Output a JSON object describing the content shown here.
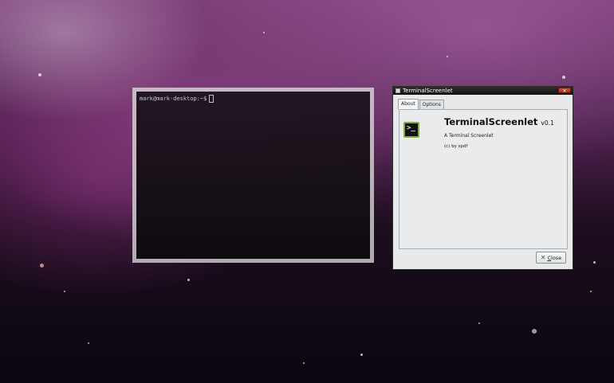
{
  "terminal": {
    "prompt": "mark@mark-desktop:~$"
  },
  "dialog": {
    "title": "TerminalScreenlet",
    "tabs": [
      {
        "label": "About",
        "active": true
      },
      {
        "label": "Options",
        "active": false
      }
    ],
    "about": {
      "app_icon": "terminal-icon",
      "name": "TerminalScreenlet",
      "version": "v0.1",
      "description": "A Terminal Screenlet",
      "copyright": "(c) by spdf"
    },
    "close_button": {
      "icon": "close-icon",
      "label_accel": "C",
      "label_rest": "lose"
    }
  },
  "colors": {
    "icon_border": "#7fae3a",
    "titlebar": "#1a1a1a",
    "dialog_bg": "#e7e9ea"
  }
}
